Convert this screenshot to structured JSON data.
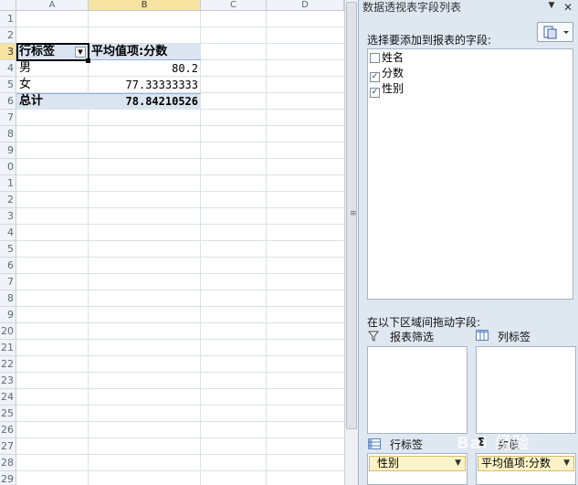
{
  "sheet": {
    "columns": [
      "A",
      "B",
      "C",
      "D"
    ],
    "rows": [
      "1",
      "2",
      "3",
      "4",
      "5",
      "6",
      "7",
      "8",
      "9",
      "0",
      "1",
      "2",
      "3",
      "4",
      "5",
      "6",
      "7",
      "8",
      "9",
      "20",
      "21",
      "22",
      "23",
      "24",
      "25",
      "26",
      "27",
      "28",
      "29"
    ],
    "pivot": {
      "header": {
        "row_label": "行标签",
        "value_label": "平均值项:分数"
      },
      "data": [
        {
          "label": "男",
          "value": "80.2"
        },
        {
          "label": "女",
          "value": "77.33333333"
        }
      ],
      "total": {
        "label": "总计",
        "value": "78.84210526"
      }
    }
  },
  "pane": {
    "title": "数据透视表字段列表",
    "choose_label": "选择要添加到报表的字段:",
    "fields": [
      {
        "name": "姓名",
        "checked": false,
        "mark": ""
      },
      {
        "name": "分数",
        "checked": true,
        "mark": "✓"
      },
      {
        "name": "性别",
        "checked": true,
        "mark": "✓"
      }
    ],
    "drag_label": "在以下区域间拖动字段:",
    "zones": {
      "filter": "报表筛选",
      "column": "列标签",
      "row": "行标签",
      "values": "数值"
    },
    "row_chip": "性别",
    "value_chip": "平均值项:分数",
    "dropdown_glyph": "▼",
    "close_glyph": "✕"
  },
  "watermark": "Bai 经验"
}
